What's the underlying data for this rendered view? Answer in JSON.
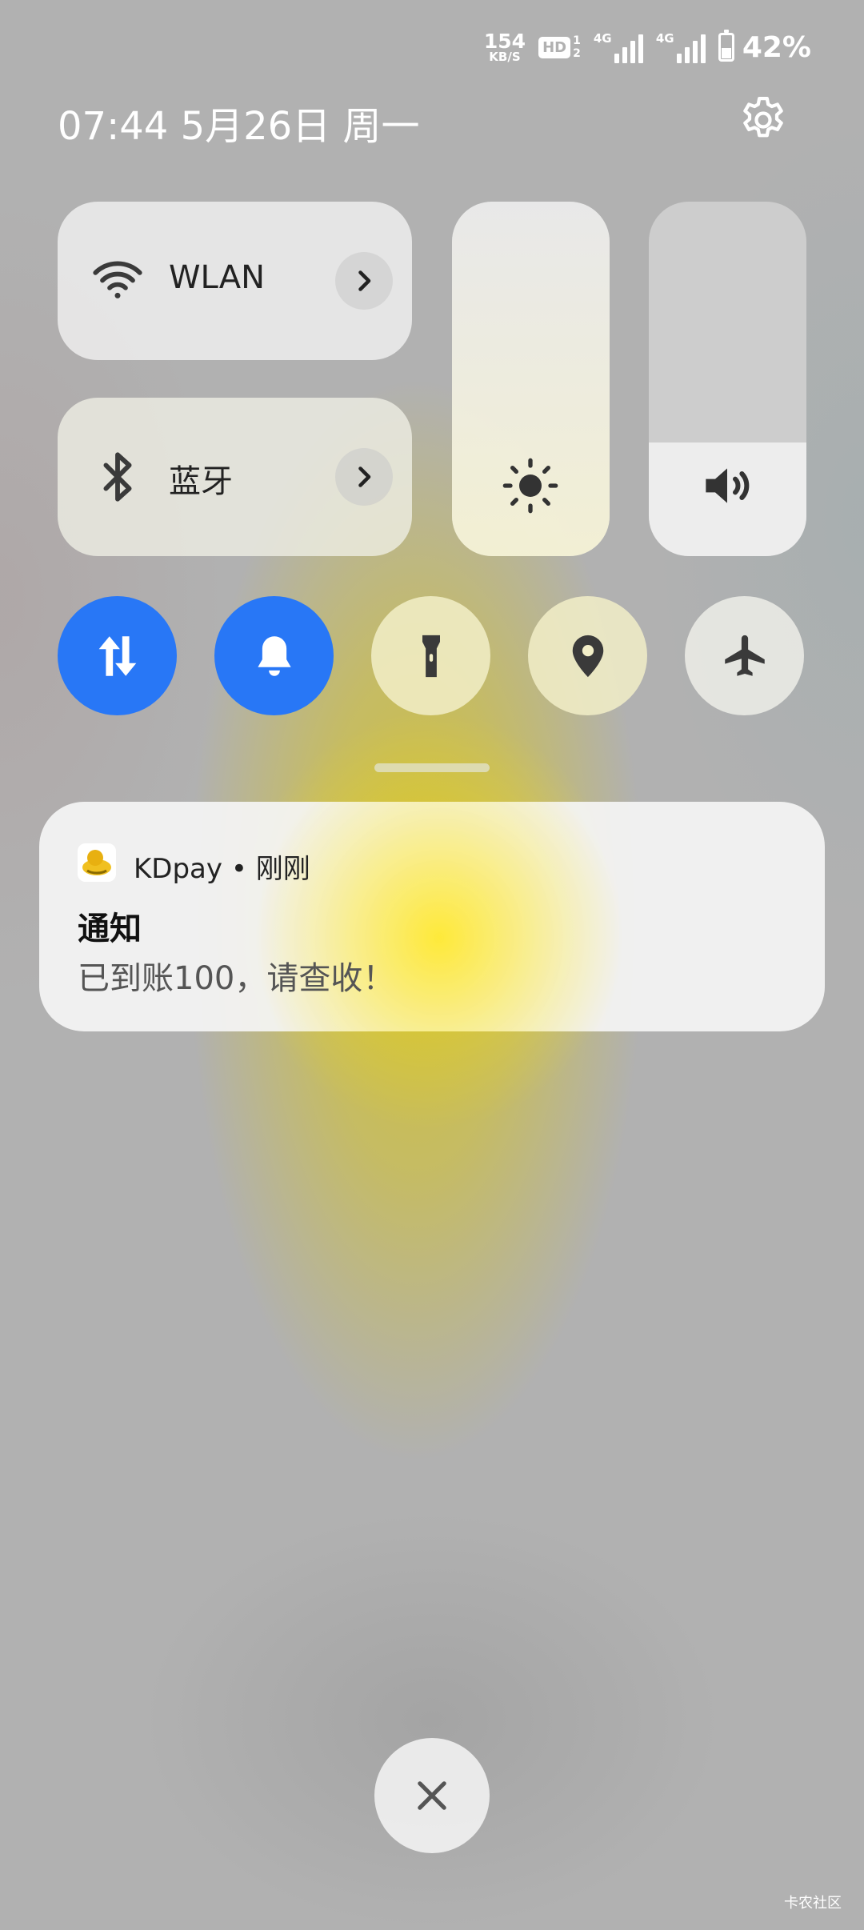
{
  "status_bar": {
    "net_speed": "154",
    "net_speed_unit": "KB/S",
    "hd_label": "HD",
    "hd_top": "1",
    "hd_bottom": "2",
    "sim1_label": "4G",
    "sim2_label": "4G",
    "battery_percent": "42%",
    "battery_level": 0.42
  },
  "header": {
    "datetime": "07:44  5月26日 周一",
    "settings_icon": "gear-icon"
  },
  "tiles": {
    "wlan": {
      "label": "WLAN",
      "icon": "wifi-icon"
    },
    "bluetooth": {
      "label": "蓝牙",
      "icon": "bluetooth-icon"
    }
  },
  "sliders": {
    "brightness": {
      "icon": "sun-icon"
    },
    "volume": {
      "icon": "speaker-icon",
      "level": 0.32
    }
  },
  "toggles": [
    {
      "name": "mobile-data",
      "icon": "data-arrows-icon",
      "on": true
    },
    {
      "name": "sound",
      "icon": "bell-icon",
      "on": true
    },
    {
      "name": "flashlight",
      "icon": "flashlight-icon",
      "on": false
    },
    {
      "name": "location",
      "icon": "location-pin-icon",
      "on": false
    },
    {
      "name": "airplane-mode",
      "icon": "airplane-icon",
      "on": false
    }
  ],
  "notification": {
    "app_name": "KDpay",
    "separator": "•",
    "time": "刚刚",
    "title": "通知",
    "body": "已到账100，请查收！"
  },
  "watermark": "卡农社区",
  "colors": {
    "accent_blue": "#2877f6",
    "background": "#b1b1b1",
    "highlight_yellow": "#ffe828"
  }
}
